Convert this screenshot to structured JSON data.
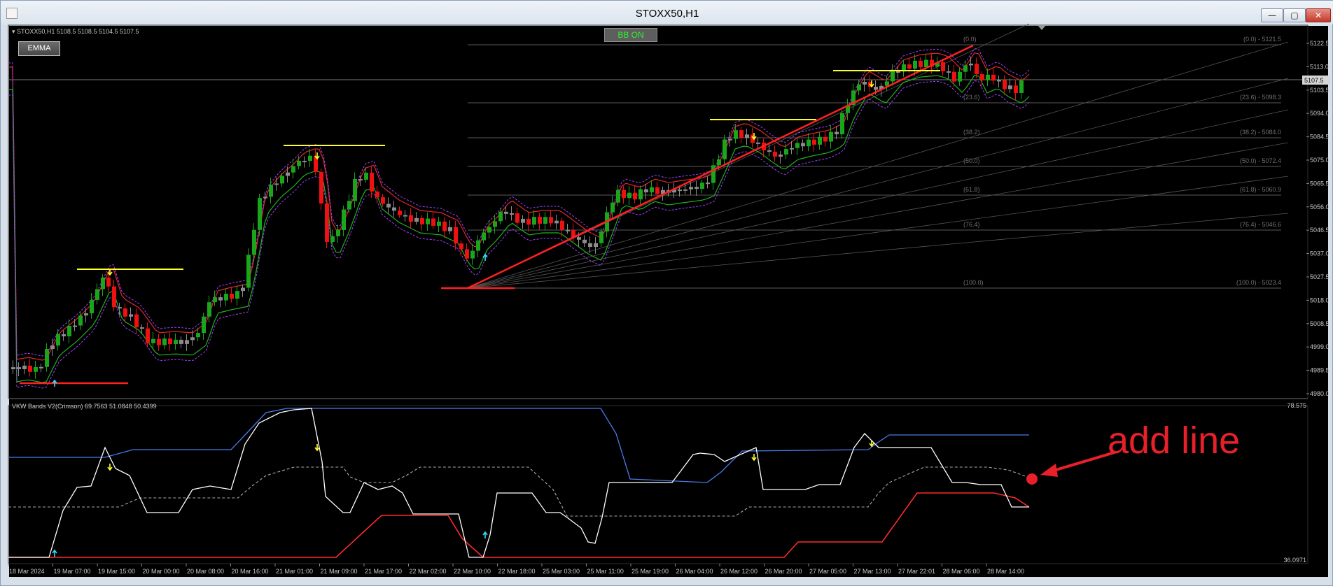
{
  "window": {
    "title": "STOXX50,H1",
    "min": "—",
    "max": "▢",
    "close": "✕"
  },
  "main_chart": {
    "info": "STOXX50,H1  5108.5 5108.5 5104.5 5107.5",
    "emma_button": "EMMA",
    "bb_button": "BB ON",
    "price_tag": "5107.5",
    "price_ticks": [
      "5122.5",
      "5113.0",
      "5103.5",
      "5094.0",
      "5084.5",
      "5075.0",
      "5065.5",
      "5056.0",
      "5046.5",
      "5037.0",
      "5027.5",
      "5018.0",
      "5008.5",
      "4999.0",
      "4989.5",
      "4980.0"
    ],
    "fib_tops": [
      "(0.0)",
      "(23.6)",
      "(38.2)",
      "(50.0)",
      "(61.8)",
      "(76.4)",
      "(100.0)"
    ],
    "fib_right": [
      "(0.0) - 5121.5",
      "(23.6) - 5098.3",
      "(38.2) - 5084.0",
      "(50.0) - 5072.4",
      "(61.8) - 5060.9",
      "(76.4) - 5046.6",
      "(100.0) - 5023.4"
    ]
  },
  "indicator": {
    "info": "VKW Bands V2(Crimson) 69.7563 51.0848 50.4399",
    "scale_top": "78.575",
    "scale_bottom": "36.0971",
    "annotation": "add line"
  },
  "time_axis": [
    "18 Mar 2024",
    "19 Mar 07:00",
    "19 Mar 15:00",
    "20 Mar 00:00",
    "20 Mar 08:00",
    "20 Mar 16:00",
    "21 Mar 01:00",
    "21 Mar 09:00",
    "21 Mar 17:00",
    "22 Mar 02:00",
    "22 Mar 10:00",
    "22 Mar 18:00",
    "25 Mar 03:00",
    "25 Mar 11:00",
    "25 Mar 19:00",
    "26 Mar 04:00",
    "26 Mar 12:00",
    "26 Mar 20:00",
    "27 Mar 05:00",
    "27 Mar 13:00",
    "27 Mar 22:01",
    "28 Mar 06:00",
    "28 Mar 14:00"
  ],
  "colors": {
    "bull": "#1aa51a",
    "bear": "#ee1111",
    "neutral": "#8c8c8c",
    "yellow": "#ffff2a",
    "cyan": "#33ddff",
    "annotation": "#e8202a"
  },
  "icons": {
    "arrow_down": "yellow-down-arrow-icon",
    "arrow_up": "cyan-up-arrow-icon"
  }
}
